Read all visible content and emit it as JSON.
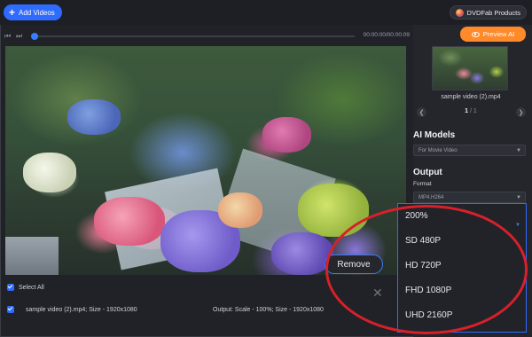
{
  "toolbar": {
    "add_videos_label": "Add Videos",
    "brand": "DVDFab Products"
  },
  "timeline": {
    "prev_icon": "skip-back-icon",
    "next_icon": "skip-forward-icon",
    "time_display": "00:00:00/00:00:09",
    "progress": 0.0
  },
  "preview": {
    "preview_ai_label": "Preview AI"
  },
  "thumbnail": {
    "name": "sample video (2).mp4",
    "page_current": "1",
    "page_sep": " / ",
    "page_total": "1"
  },
  "ai_models": {
    "title": "AI Models",
    "selected": "For Movie Video"
  },
  "output": {
    "title": "Output",
    "format_label": "Format",
    "format_value": "MP4.H264"
  },
  "resolution_dropdown": {
    "selected": "200%",
    "options": [
      "SD 480P",
      "HD 720P",
      "FHD 1080P",
      "UHD 2160P"
    ]
  },
  "file_list": {
    "select_all_label": "Select All",
    "rows": [
      {
        "name": "sample video (2).mp4; Size - 1920x1080",
        "output": "Output: Scale - 100%; Size - 1920x1080"
      }
    ]
  },
  "actions": {
    "remove_label": "Remove"
  },
  "colors": {
    "accent": "#2f6bff",
    "preview_ai": "#ff8a2a",
    "highlight": "#d8202a"
  }
}
